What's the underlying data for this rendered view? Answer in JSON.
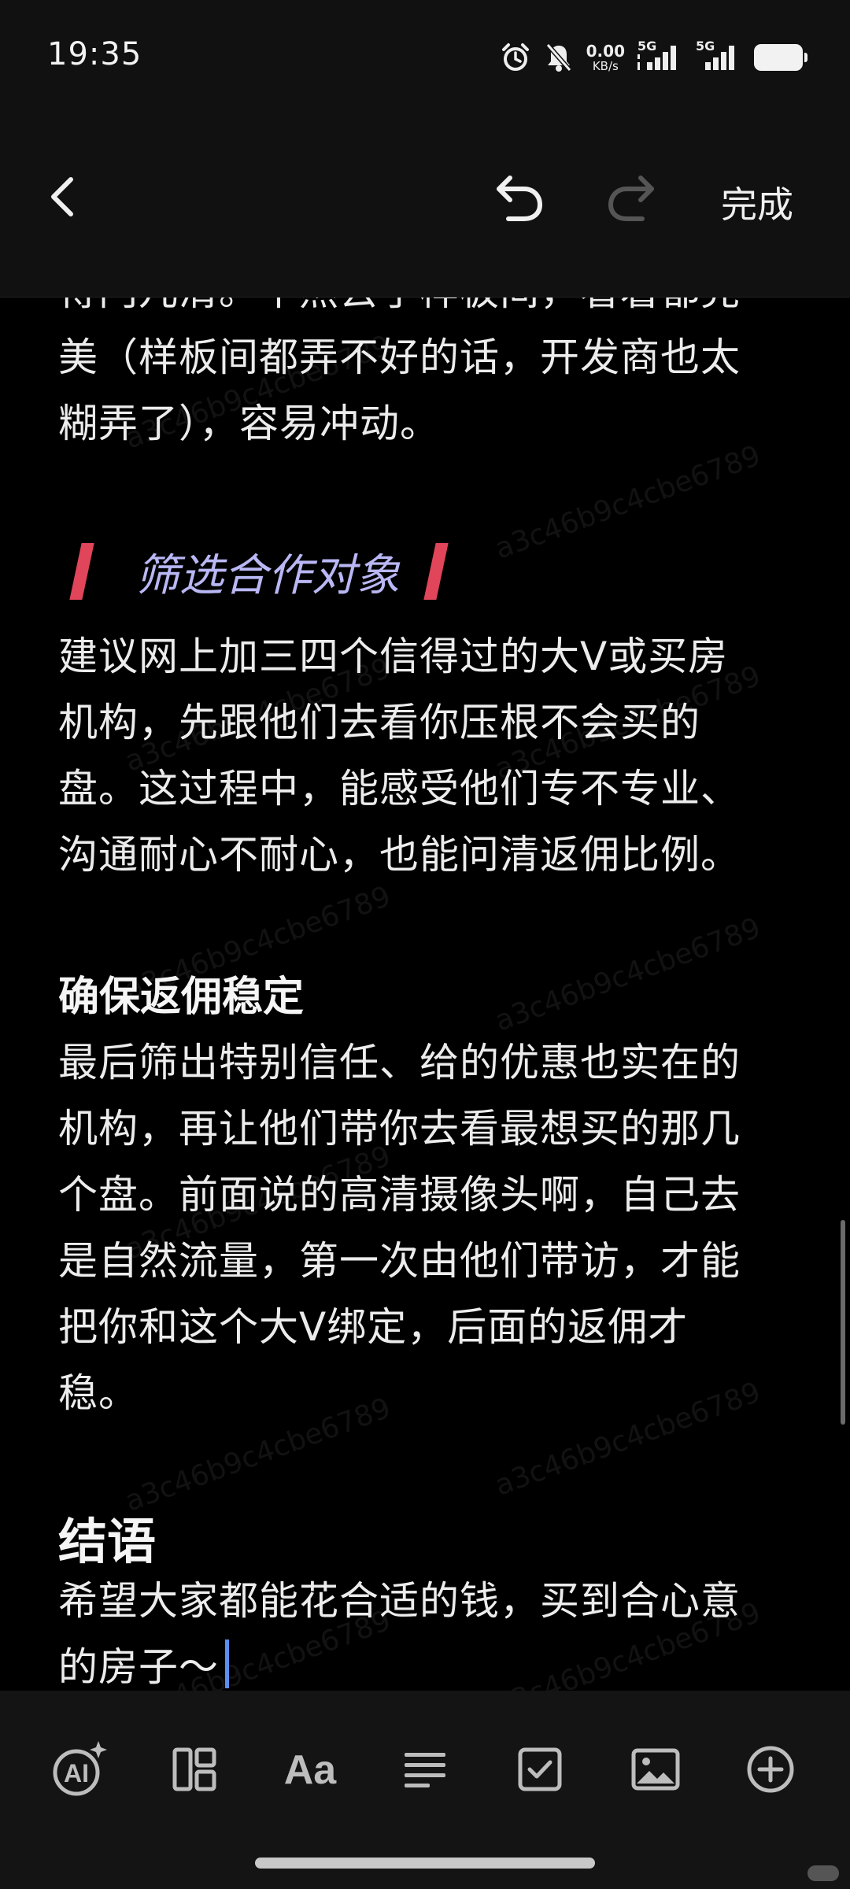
{
  "status": {
    "time": "19:35",
    "net_speed_value": "0.00",
    "net_speed_unit": "KB/s",
    "sim1_label": "5G",
    "sim2_label": "5G"
  },
  "header": {
    "done_label": "完成",
    "icons": [
      "chevron-left-icon",
      "undo-icon",
      "redo-icon"
    ]
  },
  "content": {
    "watermark": "a3c46b9c4cbe6789",
    "para1_line1": "得门儿清。不然去了样板间，看着都完",
    "para1_line2": "美（样板间都弄不好的话，开发商也太",
    "para1_line3": "糊弄了），容易冲动。",
    "section1_heading": "筛选合作对象",
    "para2_line1": "建议网上加三四个信得过的大V或买房",
    "para2_line2": "机构，先跟他们去看你压根不会买的",
    "para2_line3": "盘。这过程中，能感受他们专不专业、",
    "para2_line4": "沟通耐心不耐心，也能问清返佣比例。",
    "section2_heading": "确保返佣稳定",
    "para3_line1": "最后筛出特别信任、给的优惠也实在的",
    "para3_line2": "机构，再让他们带你去看最想买的那几",
    "para3_line3": "个盘。前面说的高清摄像头啊，自己去",
    "para3_line4": "是自然流量，第一次由他们带访，才能",
    "para3_line5": "把你和这个大V绑定，后面的返佣才",
    "para3_line6": "稳。",
    "section3_heading": "结语",
    "para4_line1": "希望大家都能花合适的钱，买到合心意",
    "para4_line2": "的房子～"
  },
  "toolbar": {
    "ai_label": "AI",
    "font_label": "Aa",
    "icons": [
      "ai-assistant-icon",
      "layout-icon",
      "font-style-icon",
      "align-icon",
      "checkbox-icon",
      "image-icon",
      "add-icon"
    ]
  },
  "colors": {
    "background": "#000000",
    "accent_bar": "#e0455a",
    "heading_purple": "#b9b7f4",
    "cursor": "#5b8ff0"
  }
}
